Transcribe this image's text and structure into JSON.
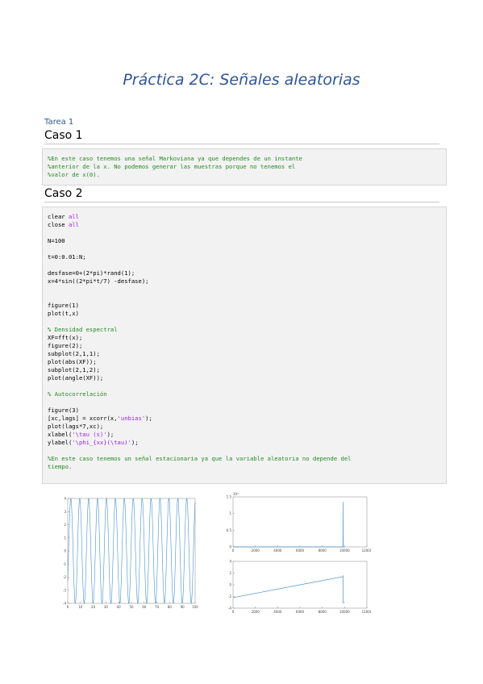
{
  "document": {
    "title": "Práctica 2C: Señales aleatorias",
    "subtitle": "Tarea 1",
    "caso1": {
      "heading": "Caso 1",
      "lines": [
        [
          {
            "t": "%En este caso tenemos una señal Markoviana ya que dependes de un instante",
            "c": "cm"
          }
        ],
        [
          {
            "t": "%anterior de la x. No podemos generar las muestras porque no tenemos el",
            "c": "cm"
          }
        ],
        [
          {
            "t": "%valor de x(0).",
            "c": "cm"
          }
        ]
      ]
    },
    "caso2": {
      "heading": "Caso 2",
      "lines": [
        [
          {
            "t": "clear ",
            "c": ""
          },
          {
            "t": "all",
            "c": "st"
          }
        ],
        [
          {
            "t": "close ",
            "c": ""
          },
          {
            "t": "all",
            "c": "st"
          }
        ],
        [],
        [
          {
            "t": "N=100",
            "c": ""
          }
        ],
        [],
        [
          {
            "t": "t=0:0.01:N;",
            "c": ""
          }
        ],
        [],
        [
          {
            "t": "desfase=0+(2*pi)*rand(1);",
            "c": ""
          }
        ],
        [
          {
            "t": "x=4*sin((2*pi*t/7) -desfase);",
            "c": ""
          }
        ],
        [],
        [],
        [
          {
            "t": "figure(1)",
            "c": ""
          }
        ],
        [
          {
            "t": "plot(t,x)",
            "c": ""
          }
        ],
        [],
        [
          {
            "t": "% Densidad espectral",
            "c": "cm"
          }
        ],
        [
          {
            "t": "XF=fft(x);",
            "c": ""
          }
        ],
        [
          {
            "t": "figure(2);",
            "c": ""
          }
        ],
        [
          {
            "t": "subplot(2,1,1);",
            "c": ""
          }
        ],
        [
          {
            "t": "plot(abs(XF));",
            "c": ""
          }
        ],
        [
          {
            "t": "subplot(2,1,2);",
            "c": ""
          }
        ],
        [
          {
            "t": "plot(angle(XF));",
            "c": ""
          }
        ],
        [],
        [
          {
            "t": "% Autocorrelación",
            "c": "cm"
          }
        ],
        [],
        [
          {
            "t": "figure(3)",
            "c": ""
          }
        ],
        [
          {
            "t": "[xc,lags] = xcorr(x,",
            "c": ""
          },
          {
            "t": "'unbias'",
            "c": "st"
          },
          {
            "t": ");",
            "c": ""
          }
        ],
        [
          {
            "t": "plot(lags*7,xc);",
            "c": ""
          }
        ],
        [
          {
            "t": "xlabel(",
            "c": ""
          },
          {
            "t": "'\\tau (s)'",
            "c": "st"
          },
          {
            "t": ");",
            "c": ""
          }
        ],
        [
          {
            "t": "ylabel(",
            "c": ""
          },
          {
            "t": "'\\phi_{xx}(\\tau)'",
            "c": "st"
          },
          {
            "t": ");",
            "c": ""
          }
        ],
        [],
        [
          {
            "t": "%En este caso tenemos un señal estacionaria ya que la variable aleatoria no depende del",
            "c": "cm"
          }
        ],
        [
          {
            "t": "tiempo.",
            "c": "cm"
          }
        ]
      ]
    }
  },
  "colors": {
    "title": "#2f5597",
    "comment": "#228b22",
    "string": "#a020f0",
    "plot_line": "#4a90c8",
    "code_bg": "#f2f2f2"
  },
  "chart_data": [
    {
      "type": "line",
      "function": "4*sin(2*pi*t/7 - desfase)",
      "x_start": 0,
      "x_end": 100,
      "amplitude": 4,
      "period": 7,
      "xlim": [
        0,
        100
      ],
      "ylim": [
        -4,
        4
      ],
      "xticks": [
        "0",
        "10",
        "20",
        "30",
        "40",
        "50",
        "60",
        "70",
        "80",
        "90",
        "100"
      ],
      "yticks": [
        "4",
        "3",
        "2",
        "1",
        "0",
        "-1",
        "-2",
        "-3",
        "-4"
      ]
    },
    {
      "type": "line",
      "x": [
        0,
        9860,
        9870,
        9880,
        10001
      ],
      "y": [
        0,
        0,
        1.35,
        0,
        0
      ],
      "xlim": [
        0,
        12000
      ],
      "ylim": [
        0,
        1.5
      ],
      "multiplier": "10⁴",
      "xticks": [
        "0",
        "2000",
        "4000",
        "6000",
        "8000",
        "10000",
        "12000"
      ],
      "yticks": [
        "1.5",
        "1",
        "0.5",
        "0"
      ]
    },
    {
      "type": "line",
      "x": [
        0,
        9860,
        9870,
        9880,
        10001
      ],
      "y": [
        -2.2,
        1.4,
        1.6,
        -3.1,
        -3.1
      ],
      "xlim": [
        0,
        12000
      ],
      "ylim": [
        -4,
        4
      ],
      "xticks": [
        "0",
        "2000",
        "4000",
        "6000",
        "8000",
        "10000",
        "12000"
      ],
      "yticks": [
        "4",
        "2",
        "0",
        "-2",
        "-4"
      ]
    }
  ]
}
